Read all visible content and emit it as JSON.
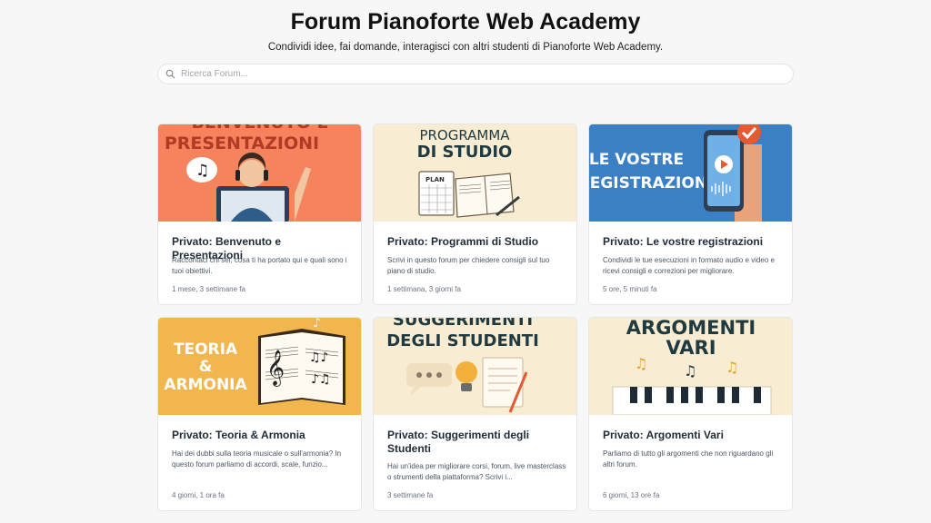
{
  "header": {
    "title": "Forum Pianoforte Web Academy",
    "subtitle": "Condividi idee, fai domande, interagisci con altri studenti di Pianoforte Web Academy."
  },
  "search": {
    "placeholder": "Ricerca Forum..."
  },
  "forums": [
    {
      "banner_text": [
        "BENVENUTO E",
        "PRESENTAZIONI"
      ],
      "title": "Privato: Benvenuto e Presentazioni",
      "description": "Raccontaci chi sei, cosa ti ha portato qui e quali sono i tuoi obiettivi.",
      "time": "1 mese, 3 settimane fa"
    },
    {
      "banner_text": [
        "PROGRAMMA",
        "DI STUDIO",
        "PLAN"
      ],
      "title": "Privato: Programmi di Studio",
      "description": "Scrivi in questo forum per chiedere consigli sul tuo piano di studio.",
      "time": "1 settimana, 3 giorni fa"
    },
    {
      "banner_text": [
        "LE VOSTRE",
        "REGISTRAZIONI"
      ],
      "title": "Privato: Le vostre registrazioni",
      "description": "Condividi le tue esecuzioni in formato audio e video e ricevi consigli e correzioni per migliorare.",
      "time": "5 ore, 5 minuti fa"
    },
    {
      "banner_text": [
        "TEORIA",
        "&",
        "ARMONIA"
      ],
      "title": "Privato: Teoria & Armonia",
      "description": "Hai dei dubbi sulla teoria musicale o sull'armonia? In questo forum parliamo di accordi, scale, funzio...",
      "time": "4 giorni, 1 ora fa"
    },
    {
      "banner_text": [
        "SUGGERIMENTI",
        "DEGLI STUDENTI"
      ],
      "title": "Privato: Suggerimenti degli Studenti",
      "description": "Hai un'idea per migliorare corsi, forum, live masterclass o strumenti della piattaforma? Scrivi i...",
      "time": "3 settimane fa"
    },
    {
      "banner_text": [
        "ARGOMENTI",
        "VARI"
      ],
      "title": "Privato: Argomenti Vari",
      "description": "Parliamo di tutto gli argomenti che non riguardano gli altri forum.",
      "time": "6 giorni, 13 ore fa"
    }
  ],
  "colors": {
    "banner_welcome": "#f5845e",
    "banner_program": "#f8ecd2",
    "banner_recordings": "#3b7fc4",
    "banner_theory": "#f2b64f",
    "banner_suggestions": "#f8ecd2",
    "banner_misc": "#f8ecd2",
    "heading_dark": "#1f3a40"
  }
}
